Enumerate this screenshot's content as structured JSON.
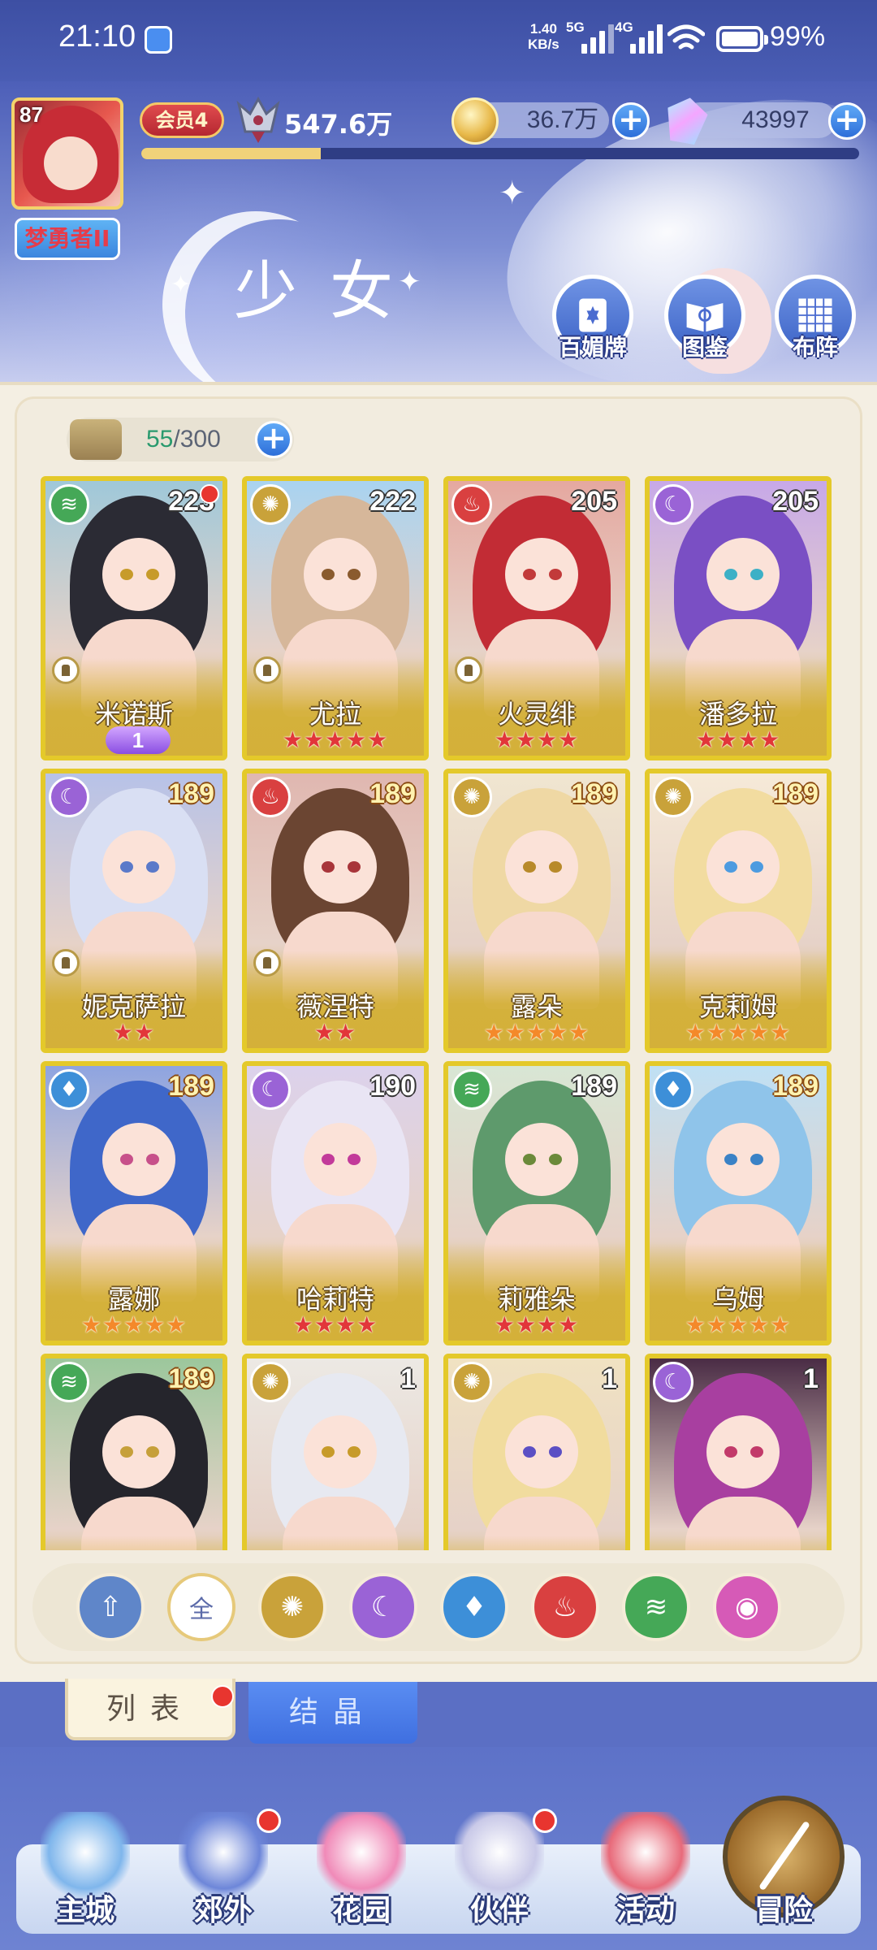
{
  "status_bar": {
    "time": "21:10",
    "net_speed_value": "1.40",
    "net_speed_unit": "KB/s",
    "net_type_1": "5G",
    "net_type_2": "4G",
    "battery": "99%"
  },
  "header": {
    "player_level": "87",
    "player_title": "梦勇者II",
    "vip_label": "会员4",
    "power_value": "547.6万",
    "power_progress": 0.25,
    "gold_value": "36.7万",
    "diamond_value": "43997",
    "page_title": "少女",
    "buttons": [
      {
        "id": "baimei",
        "label": "百媚牌",
        "icon": "card-deck-icon"
      },
      {
        "id": "tujian",
        "label": "图鉴",
        "icon": "book-icon"
      },
      {
        "id": "buzhen",
        "label": "布阵",
        "icon": "grid-formation-icon"
      }
    ]
  },
  "capacity": {
    "current": "55",
    "max": "/300"
  },
  "cards": [
    {
      "name": "米诺斯",
      "level": "223",
      "element": "wind",
      "stars": "",
      "star_color": "",
      "awaken": "1",
      "red_dot": true,
      "role_icon": true,
      "level_gold": false,
      "hair": "#2b2b34",
      "bg": "#9fc8d9",
      "eye": "#c79b2a"
    },
    {
      "name": "尤拉",
      "level": "222",
      "element": "light",
      "stars": "★★★★★",
      "star_color": "red",
      "awaken": "",
      "red_dot": false,
      "role_icon": true,
      "level_gold": false,
      "hair": "#d6b79a",
      "bg": "#a9d3f0",
      "eye": "#8a5b2e"
    },
    {
      "name": "火灵绯",
      "level": "205",
      "element": "fire",
      "stars": "★★★★",
      "star_color": "red",
      "awaken": "",
      "red_dot": false,
      "role_icon": true,
      "level_gold": false,
      "hair": "#c22c35",
      "bg": "#e5a8a0",
      "eye": "#c23a3a"
    },
    {
      "name": "潘多拉",
      "level": "205",
      "element": "dark",
      "stars": "★★★★",
      "star_color": "red",
      "awaken": "",
      "red_dot": false,
      "role_icon": false,
      "level_gold": false,
      "hair": "#7a4fc4",
      "bg": "#c7a8e8",
      "eye": "#3db0c6"
    },
    {
      "name": "妮克萨拉",
      "level": "189",
      "element": "dark",
      "stars": "★★",
      "star_color": "red",
      "awaken": "",
      "red_dot": false,
      "role_icon": true,
      "level_gold": true,
      "hair": "#d9dff3",
      "bg": "#b7c2e8",
      "eye": "#5a79c9"
    },
    {
      "name": "薇涅特",
      "level": "189",
      "element": "fire",
      "stars": "★★",
      "star_color": "red",
      "awaken": "",
      "red_dot": false,
      "role_icon": true,
      "level_gold": true,
      "hair": "#6b4532",
      "bg": "#e0b7b0",
      "eye": "#a8353a"
    },
    {
      "name": "露朵",
      "level": "189",
      "element": "light",
      "stars": "★★★★★",
      "star_color": "orange",
      "awaken": "",
      "red_dot": false,
      "role_icon": false,
      "level_gold": true,
      "hair": "#efd8a4",
      "bg": "#f0e6d0",
      "eye": "#b88a2a"
    },
    {
      "name": "克莉姆",
      "level": "189",
      "element": "light",
      "stars": "★★★★★",
      "star_color": "orange",
      "awaken": "",
      "red_dot": false,
      "role_icon": false,
      "level_gold": true,
      "hair": "#f2dca0",
      "bg": "#f6ead8",
      "eye": "#4d9be0"
    },
    {
      "name": "露娜",
      "level": "189",
      "element": "water",
      "stars": "★★★★★",
      "star_color": "orange",
      "awaken": "",
      "red_dot": false,
      "role_icon": false,
      "level_gold": true,
      "hair": "#3f67c9",
      "bg": "#8ea4e0",
      "eye": "#c7508a"
    },
    {
      "name": "哈莉特",
      "level": "190",
      "element": "dark",
      "stars": "★★★★",
      "star_color": "red",
      "awaken": "",
      "red_dot": false,
      "role_icon": false,
      "level_gold": false,
      "hair": "#e9e5f4",
      "bg": "#dcd2ec",
      "eye": "#c23a9a"
    },
    {
      "name": "莉雅朵",
      "level": "189",
      "element": "wind",
      "stars": "★★★★",
      "star_color": "red",
      "awaken": "",
      "red_dot": false,
      "role_icon": false,
      "level_gold": false,
      "hair": "#5e9a6c",
      "bg": "#d8e6d4",
      "eye": "#6b8a3a"
    },
    {
      "name": "乌姆",
      "level": "189",
      "element": "water",
      "stars": "★★★★★",
      "star_color": "orange",
      "awaken": "",
      "red_dot": false,
      "role_icon": false,
      "level_gold": true,
      "hair": "#8fc4ea",
      "bg": "#bfe0f4",
      "eye": "#3a82c6"
    },
    {
      "name": "",
      "level": "189",
      "element": "wind",
      "stars": "",
      "star_color": "",
      "awaken": "",
      "red_dot": false,
      "role_icon": false,
      "level_gold": true,
      "hair": "#25252c",
      "bg": "#9cc79c",
      "eye": "#c6a03a"
    },
    {
      "name": "",
      "level": "1",
      "element": "light",
      "stars": "",
      "star_color": "",
      "awaken": "",
      "red_dot": false,
      "role_icon": false,
      "level_gold": false,
      "hair": "#e7e9f1",
      "bg": "#ece9e4",
      "eye": "#c79b2a"
    },
    {
      "name": "",
      "level": "1",
      "element": "light",
      "stars": "",
      "star_color": "",
      "awaken": "",
      "red_dot": false,
      "role_icon": false,
      "level_gold": false,
      "hair": "#f1dc9e",
      "bg": "#f0e2c2",
      "eye": "#5b4fc4"
    },
    {
      "name": "",
      "level": "1",
      "element": "dark",
      "stars": "",
      "star_color": "",
      "awaken": "",
      "red_dot": false,
      "role_icon": false,
      "level_gold": false,
      "hair": "#a83fa0",
      "bg": "#4a2c45",
      "eye": "#c23a6a"
    }
  ],
  "filters": [
    {
      "id": "rank",
      "label": "",
      "icon": "sort-up-icon",
      "color": "#5f86c9",
      "selected": false
    },
    {
      "id": "all",
      "label": "全",
      "icon": "all-icon",
      "color": "#ffffff",
      "selected": true
    },
    {
      "id": "light",
      "label": "",
      "icon": "sun-icon",
      "color": "#c9a23a",
      "selected": false
    },
    {
      "id": "dark",
      "label": "",
      "icon": "moon-icon",
      "color": "#9a63d6",
      "selected": false
    },
    {
      "id": "water",
      "label": "",
      "icon": "water-drop-icon",
      "color": "#3d8fd8",
      "selected": false
    },
    {
      "id": "fire",
      "label": "",
      "icon": "flame-icon",
      "color": "#d94040",
      "selected": false
    },
    {
      "id": "wind",
      "label": "",
      "icon": "wind-icon",
      "color": "#45a857",
      "selected": false
    },
    {
      "id": "spirit",
      "label": "",
      "icon": "orb-icon",
      "color": "#d65ab7",
      "selected": false
    }
  ],
  "element_colors": {
    "wind": "#45a857",
    "light": "#c9a23a",
    "fire": "#d94040",
    "dark": "#9a63d6",
    "water": "#3d8fd8"
  },
  "element_glyphs": {
    "wind": "≋",
    "light": "✺",
    "fire": "♨",
    "dark": "☾",
    "water": "♦"
  },
  "tabs": {
    "list_label": "列表",
    "crystal_label": "结晶"
  },
  "bottom_nav": [
    {
      "id": "main-city",
      "label": "主城",
      "icon": "castle-icon",
      "red_dot": false
    },
    {
      "id": "outskirts",
      "label": "郊外",
      "icon": "magic-circle-icon",
      "red_dot": true
    },
    {
      "id": "garden",
      "label": "花园",
      "icon": "heart-icon",
      "red_dot": false
    },
    {
      "id": "partner",
      "label": "伙伴",
      "icon": "partner-portrait-icon",
      "red_dot": true
    },
    {
      "id": "activity",
      "label": "活动",
      "icon": "gift-box-icon",
      "red_dot": false
    },
    {
      "id": "adventure",
      "label": "冒险",
      "icon": "compass-icon",
      "red_dot": false
    }
  ]
}
